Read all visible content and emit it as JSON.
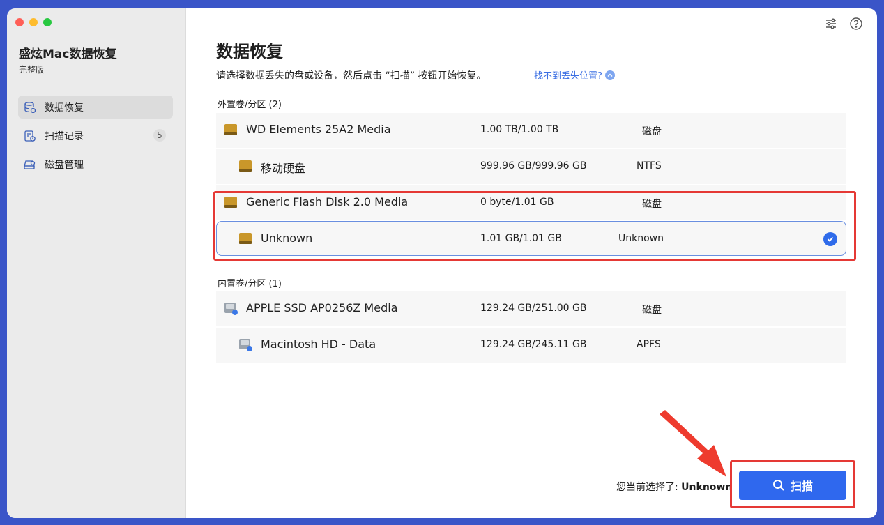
{
  "sidebar": {
    "app_title": "盛炫Mac数据恢复",
    "edition": "完整版",
    "items": [
      {
        "label": "数据恢复",
        "icon": "database-icon",
        "active": true
      },
      {
        "label": "扫描记录",
        "icon": "scan-history-icon",
        "badge": "5"
      },
      {
        "label": "磁盘管理",
        "icon": "disk-manage-icon"
      }
    ]
  },
  "header": {
    "title": "数据恢复",
    "subtitle": "请选择数据丢失的盘或设备，然后点击 “扫描” 按钮开始恢复。",
    "help_link": "找不到丢失位置?"
  },
  "external": {
    "label": "外置卷/分区 (2)",
    "rows": [
      {
        "name": "WD Elements 25A2 Media",
        "size": "1.00 TB/1.00 TB",
        "type": "磁盘"
      },
      {
        "name": "移动硬盘",
        "size": "999.96 GB/999.96 GB",
        "type": "NTFS"
      },
      {
        "name": "Generic Flash Disk 2.0 Media",
        "size": "0 byte/1.01 GB",
        "type": "磁盘"
      },
      {
        "name": "Unknown",
        "size": "1.01 GB/1.01 GB",
        "type": "Unknown",
        "selected": true
      }
    ]
  },
  "internal": {
    "label": "内置卷/分区 (1)",
    "rows": [
      {
        "name": "APPLE SSD AP0256Z Media",
        "size": "129.24 GB/251.00 GB",
        "type": "磁盘"
      },
      {
        "name": "Macintosh HD - Data",
        "size": "129.24 GB/245.11 GB",
        "type": "APFS"
      }
    ]
  },
  "footer": {
    "selection_prefix": "您当前选择了: ",
    "selection_value": "Unknown",
    "scan_label": "扫描"
  },
  "colors": {
    "accent": "#2f68ee",
    "highlight_box": "#e53935",
    "sidebar_bg": "#ebebeb"
  }
}
